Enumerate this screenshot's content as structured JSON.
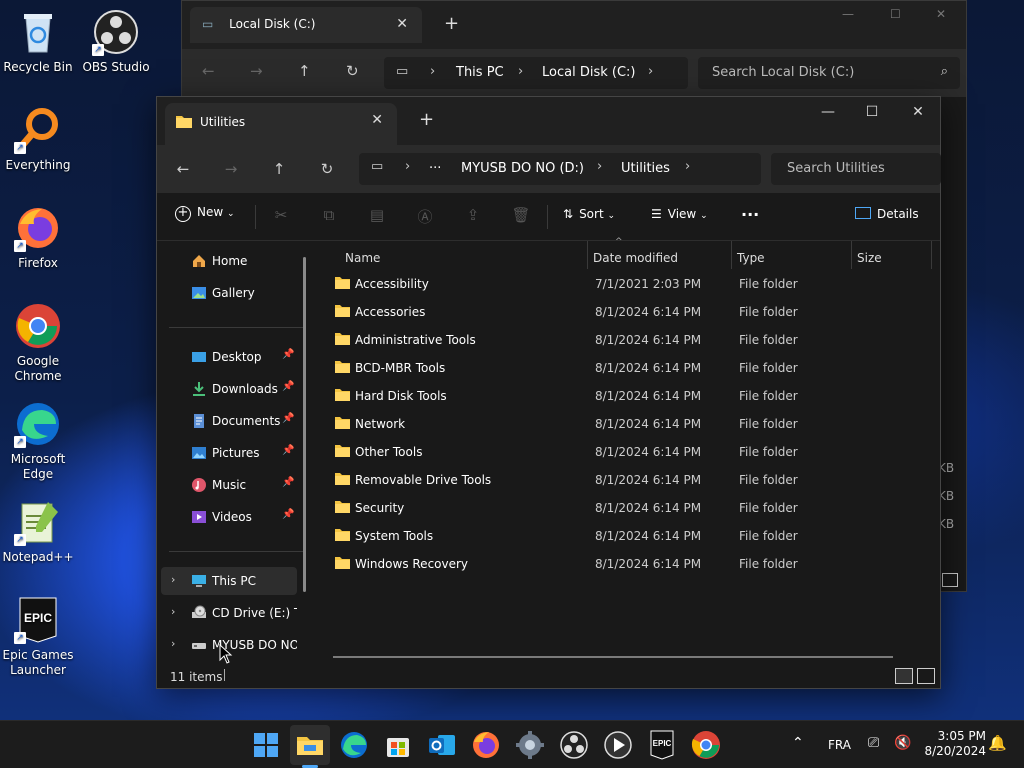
{
  "desktop": {
    "icons": [
      {
        "label": "Recycle Bin",
        "icon": "recycle-bin-icon"
      },
      {
        "label": "OBS Studio",
        "icon": "obs-icon"
      },
      {
        "label": "Everything",
        "icon": "everything-search-icon"
      },
      {
        "label": "Firefox",
        "icon": "firefox-icon"
      },
      {
        "label": "Google Chrome",
        "icon": "chrome-icon"
      },
      {
        "label": "Microsoft Edge",
        "icon": "edge-icon"
      },
      {
        "label": "Notepad++",
        "icon": "notepadpp-icon"
      },
      {
        "label": "Epic Games Launcher",
        "icon": "epic-games-icon"
      }
    ]
  },
  "back_window": {
    "tab_title": "Local Disk (C:)",
    "address": [
      "This PC",
      "Local Disk (C:)"
    ],
    "search_placeholder": "Search Local Disk (C:)",
    "partial_sizes": [
      "KB",
      "KB",
      "KB"
    ]
  },
  "window": {
    "tab_title": "Utilities",
    "new_tab": "+",
    "close_tab": "✕",
    "controls": {
      "minimize": "—",
      "maximize": "☐",
      "close": "✕"
    },
    "address": {
      "more": "···",
      "drive": "MYUSB DO NO (D:)",
      "folder": "Utilities"
    },
    "search_placeholder": "Search Utilities",
    "toolbar": {
      "new": "New",
      "sort": "Sort",
      "view": "View",
      "more": "···",
      "details": "Details"
    },
    "sidebar": {
      "top": [
        {
          "label": "Home",
          "icon": "home-icon"
        },
        {
          "label": "Gallery",
          "icon": "gallery-icon"
        }
      ],
      "pinned": [
        {
          "label": "Desktop",
          "icon": "desktop-icon"
        },
        {
          "label": "Downloads",
          "icon": "downloads-icon"
        },
        {
          "label": "Documents",
          "icon": "documents-icon"
        },
        {
          "label": "Pictures",
          "icon": "pictures-icon"
        },
        {
          "label": "Music",
          "icon": "music-icon"
        },
        {
          "label": "Videos",
          "icon": "videos-icon"
        }
      ],
      "drives": [
        {
          "label": "This PC",
          "icon": "this-pc-icon"
        },
        {
          "label": "CD Drive (E:) Tir",
          "icon": "cd-drive-icon"
        },
        {
          "label": "MYUSB DO NO",
          "icon": "usb-drive-icon"
        }
      ]
    },
    "columns": {
      "name": "Name",
      "date": "Date modified",
      "type": "Type",
      "size": "Size"
    },
    "rows": [
      {
        "name": "Accessibility",
        "date": "7/1/2021 2:03 PM",
        "type": "File folder"
      },
      {
        "name": "Accessories",
        "date": "8/1/2024 6:14 PM",
        "type": "File folder"
      },
      {
        "name": "Administrative Tools",
        "date": "8/1/2024 6:14 PM",
        "type": "File folder"
      },
      {
        "name": "BCD-MBR Tools",
        "date": "8/1/2024 6:14 PM",
        "type": "File folder"
      },
      {
        "name": "Hard Disk Tools",
        "date": "8/1/2024 6:14 PM",
        "type": "File folder"
      },
      {
        "name": "Network",
        "date": "8/1/2024 6:14 PM",
        "type": "File folder"
      },
      {
        "name": "Other Tools",
        "date": "8/1/2024 6:14 PM",
        "type": "File folder"
      },
      {
        "name": "Removable Drive Tools",
        "date": "8/1/2024 6:14 PM",
        "type": "File folder"
      },
      {
        "name": "Security",
        "date": "8/1/2024 6:14 PM",
        "type": "File folder"
      },
      {
        "name": "System Tools",
        "date": "8/1/2024 6:14 PM",
        "type": "File folder"
      },
      {
        "name": "Windows Recovery",
        "date": "8/1/2024 6:14 PM",
        "type": "File folder"
      }
    ],
    "status": "11 items"
  },
  "taskbar": {
    "apps": [
      "start-icon",
      "file-explorer-icon",
      "edge-icon",
      "store-icon",
      "outlook-icon",
      "firefox-icon",
      "settings-icon",
      "obs-icon",
      "media-player-icon",
      "epic-games-icon",
      "chrome-icon"
    ],
    "language": "FRA",
    "time": "3:05 PM",
    "date": "8/20/2024"
  },
  "colors": {
    "folder": "#f4c542",
    "accent": "#4ea7f5",
    "taskbar": "#1c1c1c",
    "window": "#191919"
  }
}
